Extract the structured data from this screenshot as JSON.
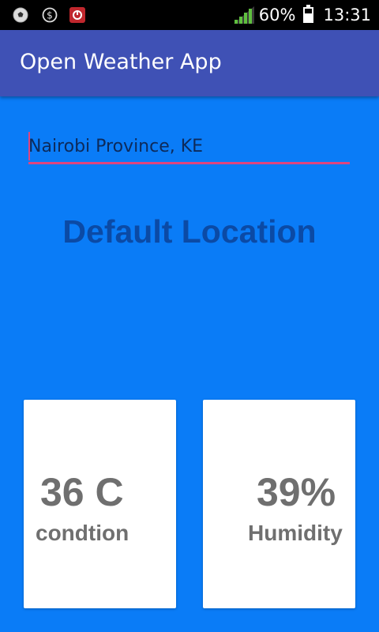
{
  "status_bar": {
    "battery_percent": "60%",
    "time": "13:31",
    "battery_level": 0.6,
    "notification_icons": [
      "soccer-ball-icon",
      "dollar-coin-icon",
      "red-app-icon"
    ]
  },
  "app_bar": {
    "title": "Open Weather App"
  },
  "search": {
    "value": "Nairobi Province, KE"
  },
  "location": {
    "title": "Default Location"
  },
  "cards": {
    "temperature": {
      "value": "36 C",
      "label": "condtion"
    },
    "humidity": {
      "value": "39%",
      "label": "Humidity"
    }
  },
  "colors": {
    "background": "#0a7cf7",
    "app_bar": "#3f51b5",
    "accent": "#e0457f",
    "heading": "#0b4aa5",
    "card_text": "#6f6f6f"
  }
}
